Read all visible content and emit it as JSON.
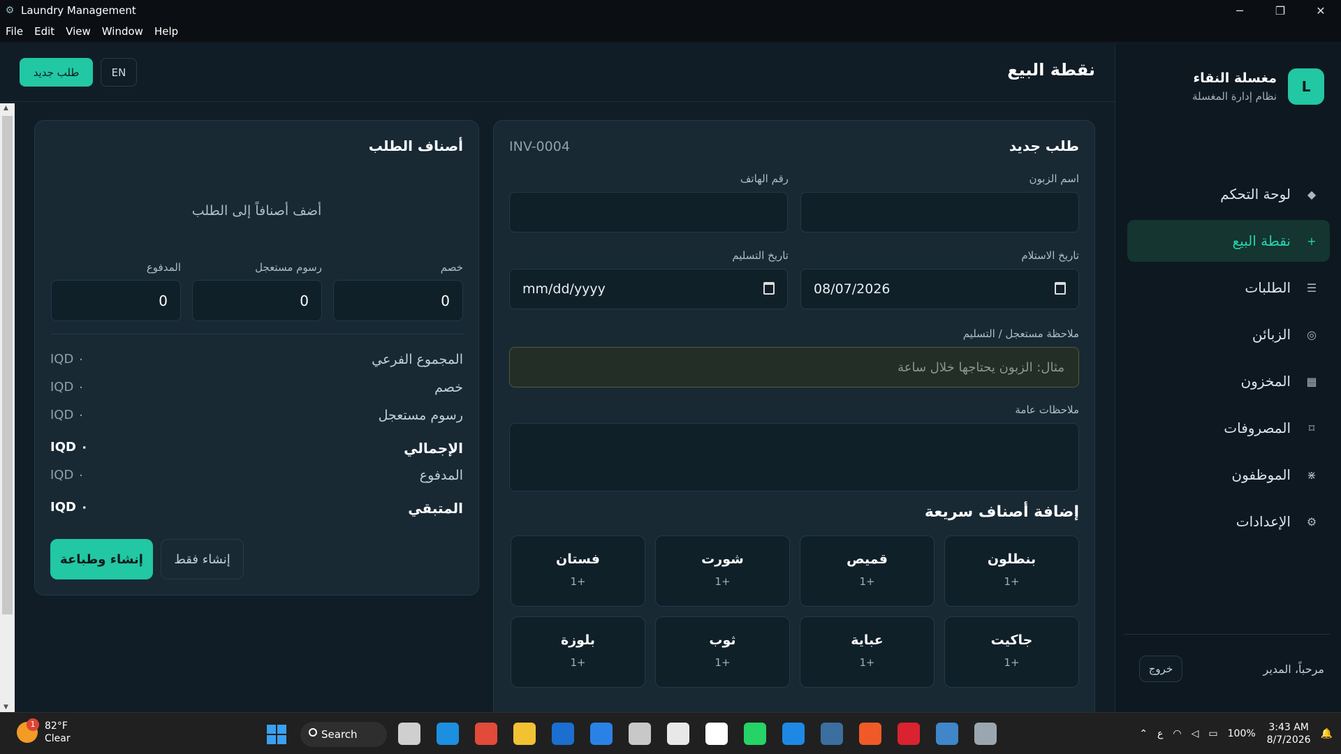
{
  "window": {
    "title": "Laundry Management",
    "controls": [
      "─",
      "❐",
      "✕"
    ]
  },
  "menu": [
    "File",
    "Edit",
    "View",
    "Window",
    "Help"
  ],
  "sidebar": {
    "brand_initial": "L",
    "brand_name": "مغسلة النقاء",
    "brand_sub": "نظام إدارة المغسلة",
    "items": [
      {
        "label": "لوحة التحكم",
        "icon": "◆",
        "icon_name": "dashboard-icon",
        "active": false
      },
      {
        "label": "نقطة البيع",
        "icon": "+",
        "icon_name": "plus-icon",
        "active": true
      },
      {
        "label": "الطلبات",
        "icon": "☰",
        "icon_name": "list-icon",
        "active": false
      },
      {
        "label": "الزبائن",
        "icon": "◎",
        "icon_name": "customers-icon",
        "active": false
      },
      {
        "label": "المخزون",
        "icon": "▦",
        "icon_name": "inventory-icon",
        "active": false
      },
      {
        "label": "المصروفات",
        "icon": "⌑",
        "icon_name": "expenses-icon",
        "active": false
      },
      {
        "label": "الموظفون",
        "icon": "⋇",
        "icon_name": "employees-icon",
        "active": false
      },
      {
        "label": "الإعدادات",
        "icon": "⚙",
        "icon_name": "settings-icon",
        "active": false
      }
    ],
    "welcome": "مرحباً، المدير",
    "logout": "خروج"
  },
  "topbar": {
    "title": "نقطة البيع",
    "new_order": "طلب جديد",
    "lang": "EN"
  },
  "order_form": {
    "title": "طلب جديد",
    "invoice": "INV-0004",
    "customer_name_label": "اسم الزبون",
    "customer_name_value": "",
    "phone_label": "رقم الهاتف",
    "phone_value": "",
    "received_date_label": "تاريخ الاستلام",
    "received_date_value": "08/07/2026",
    "delivery_date_label": "تاريخ التسليم",
    "delivery_date_value": "mm/dd/yyyy",
    "urgent_note_label": "ملاحظة مستعجل / التسليم",
    "urgent_note_placeholder": "مثال: الزبون يحتاجها خلال ساعة",
    "general_notes_label": "ملاحظات عامة",
    "quick_add_title": "إضافة أصناف سريعة",
    "quick_items": [
      {
        "name": "بنطلون",
        "plus": "1+"
      },
      {
        "name": "قميص",
        "plus": "1+"
      },
      {
        "name": "شورت",
        "plus": "1+"
      },
      {
        "name": "فستان",
        "plus": "1+"
      },
      {
        "name": "جاكيت",
        "plus": "1+"
      },
      {
        "name": "عباية",
        "plus": "1+"
      },
      {
        "name": "ثوب",
        "plus": "1+"
      },
      {
        "name": "بلوزة",
        "plus": "1+"
      }
    ]
  },
  "order_items": {
    "title": "أصناف الطلب",
    "empty": "أضف أصنافاً إلى الطلب",
    "discount_label": "خصم",
    "discount_value": "0",
    "urgent_fee_label": "رسوم مستعجل",
    "urgent_fee_value": "0",
    "paid_label": "المدفوع",
    "paid_value": "0",
    "summary": [
      {
        "label": "المجموع الفرعي",
        "value": "IQD ٠",
        "bold": false
      },
      {
        "label": "خصم",
        "value": "IQD ٠",
        "bold": false
      },
      {
        "label": "رسوم مستعجل",
        "value": "IQD ٠",
        "bold": false
      },
      {
        "label": "الإجمالي",
        "value": "IQD ٠",
        "bold": true
      },
      {
        "label": "المدفوع",
        "value": "IQD ٠",
        "bold": false
      },
      {
        "label": "المتبقي",
        "value": "IQD ٠",
        "bold": true
      }
    ],
    "create_print": "إنشاء وطباعة",
    "create_only": "إنشاء فقط"
  },
  "taskbar": {
    "temp": "82°F",
    "condition": "Clear",
    "weather_badge": "1",
    "search": "Search",
    "lang_indicator": "ع",
    "battery": "100%",
    "time": "3:43 AM",
    "date": "8/7/2026",
    "app_colors": [
      "#cfcfcf",
      "#1d8fe0",
      "#e24a3a",
      "#f2c233",
      "#1a6fd0",
      "#2b82e6",
      "#c8c8c8",
      "#e8e8e8",
      "#ffffff",
      "#25d366",
      "#1e88e5",
      "#3b6fa0",
      "#f05a28",
      "#d9232e",
      "#3f87c9",
      "#9aa7b0"
    ]
  }
}
